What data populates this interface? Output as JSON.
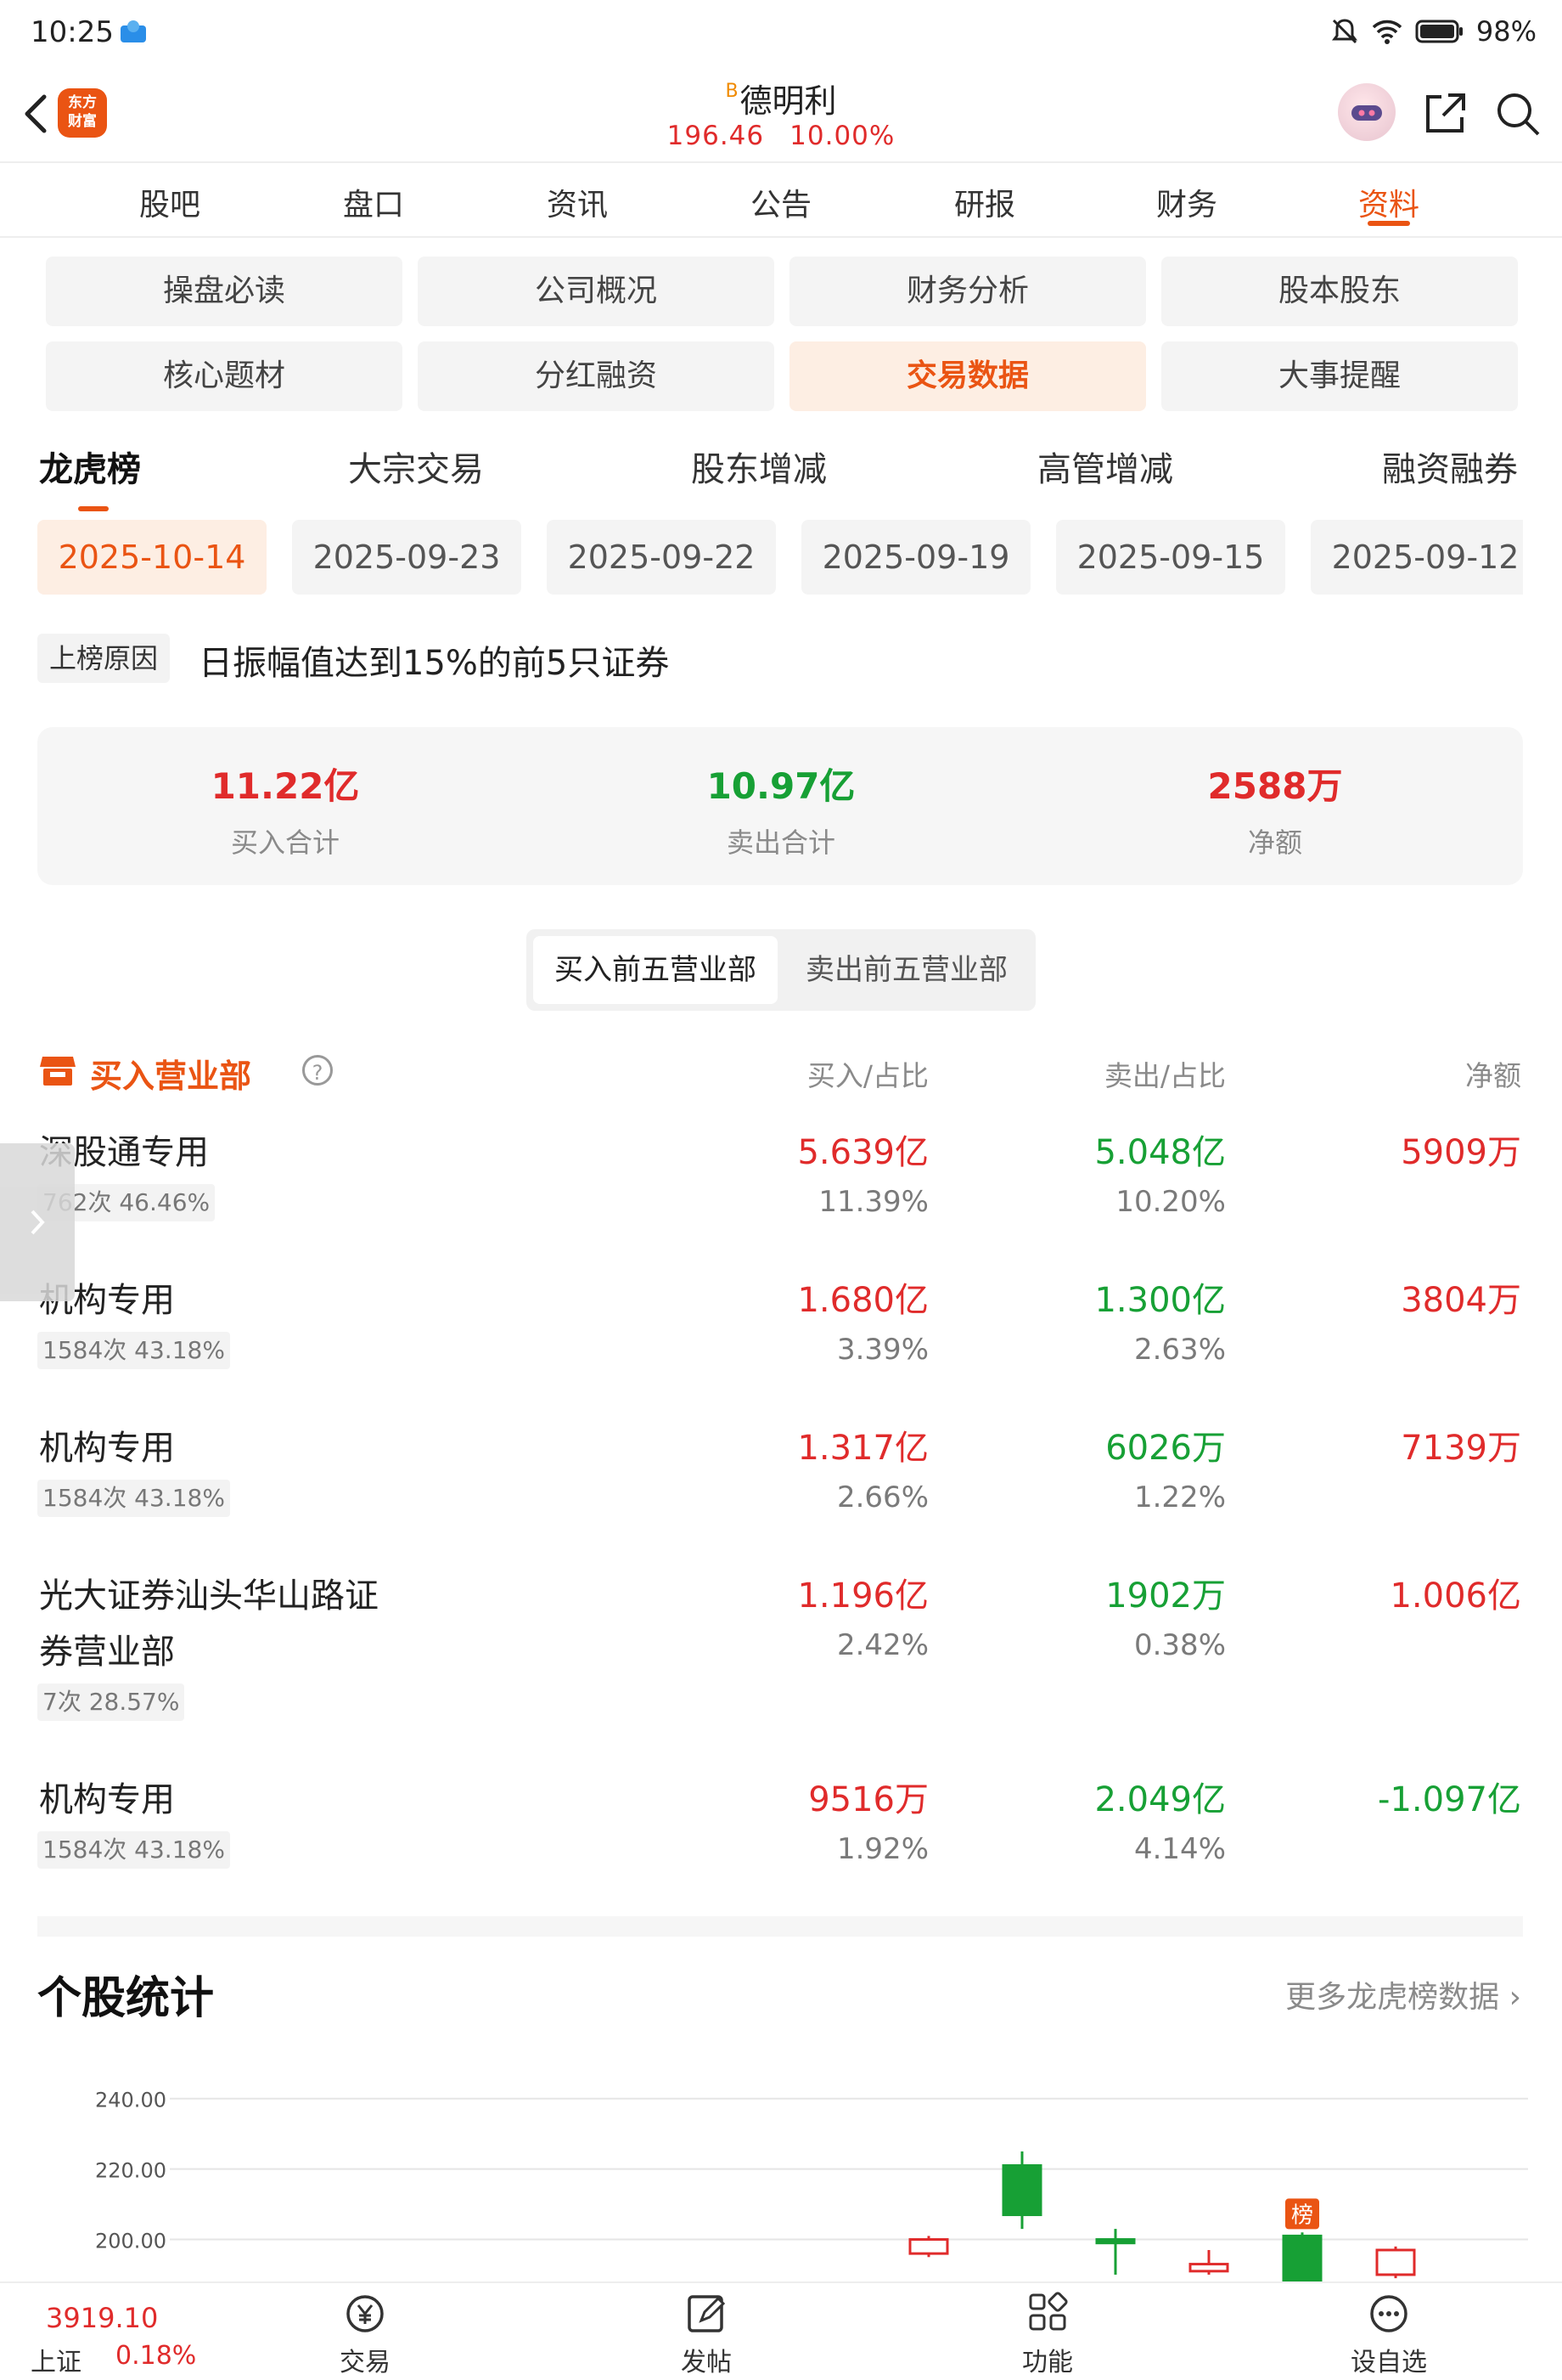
{
  "status_bar": {
    "time": "10:25",
    "battery": "98%"
  },
  "header": {
    "logo_text_1": "东方",
    "logo_text_2": "财富",
    "stock_badge": "B",
    "stock_name": "德明利",
    "price": "196.46",
    "change_pct": "10.00%"
  },
  "main_tabs": [
    "股吧",
    "盘口",
    "资讯",
    "公告",
    "研报",
    "财务",
    "资料"
  ],
  "main_tab_active": "资料",
  "grid_buttons": [
    "操盘必读",
    "公司概况",
    "财务分析",
    "股本股东",
    "核心题材",
    "分红融资",
    "交易数据",
    "大事提醒"
  ],
  "grid_active": "交易数据",
  "secondary_tabs": [
    "龙虎榜",
    "大宗交易",
    "股东增减",
    "高管增减",
    "融资融券"
  ],
  "dates": [
    "2025-10-14",
    "2025-09-23",
    "2025-09-22",
    "2025-09-19",
    "2025-09-15",
    "2025-09-12"
  ],
  "reason": {
    "tag": "上榜原因",
    "text": "日振幅值达到15%的前5只证券"
  },
  "summary": {
    "buy_total": "11.22亿",
    "buy_label": "买入合计",
    "sell_total": "10.97亿",
    "sell_label": "卖出合计",
    "net": "2588万",
    "net_label": "净额"
  },
  "segment": {
    "buy_top5": "买入前五营业部",
    "sell_top5": "卖出前五营业部"
  },
  "table": {
    "title": "买入营业部",
    "help": "?",
    "col_buy": "买入/占比",
    "col_sell": "卖出/占比",
    "col_net": "净额",
    "rows": [
      {
        "name": "深股通专用",
        "badge": "762次 46.46%",
        "buy": "5.639亿",
        "buy_pct": "11.39%",
        "sell": "5.048亿",
        "sell_pct": "10.20%",
        "net": "5909万"
      },
      {
        "name": "机构专用",
        "badge": "1584次 43.18%",
        "buy": "1.680亿",
        "buy_pct": "3.39%",
        "sell": "1.300亿",
        "sell_pct": "2.63%",
        "net": "3804万"
      },
      {
        "name": "机构专用",
        "badge": "1584次 43.18%",
        "buy": "1.317亿",
        "buy_pct": "2.66%",
        "sell": "6026万",
        "sell_pct": "1.22%",
        "net": "7139万"
      },
      {
        "name": "光大证券汕头华山路证券营业部",
        "badge": "7次 28.57%",
        "buy": "1.196亿",
        "buy_pct": "2.42%",
        "sell": "1902万",
        "sell_pct": "0.38%",
        "net": "1.006亿"
      },
      {
        "name": "机构专用",
        "badge": "1584次 43.18%",
        "buy": "9516万",
        "buy_pct": "1.92%",
        "sell": "2.049亿",
        "sell_pct": "4.14%",
        "net": "-1.097亿"
      }
    ]
  },
  "stats": {
    "title": "个股统计",
    "more": "更多龙虎榜数据"
  },
  "chart_data": {
    "type": "candlestick",
    "y_ticks": [
      "240.00",
      "220.00",
      "200.00"
    ],
    "ylim": [
      190,
      245
    ],
    "marker_label": "榜",
    "candles": [
      {
        "open": 196,
        "close": 200,
        "high": 201,
        "low": 195,
        "dir": "up"
      },
      {
        "open": 221,
        "close": 207,
        "high": 225,
        "low": 203,
        "dir": "down"
      },
      {
        "open": 200,
        "close": 199,
        "high": 203,
        "low": 190,
        "dir": "down"
      },
      {
        "open": 193,
        "close": 191,
        "high": 197,
        "low": 190,
        "dir": "up"
      },
      {
        "open": 201,
        "close": 188,
        "high": 202,
        "low": 186,
        "dir": "down",
        "marked": true
      },
      {
        "open": 190,
        "close": 197,
        "high": 198,
        "low": 189,
        "dir": "up"
      }
    ]
  },
  "bottom_bar": {
    "index_value": "3919.10",
    "index_name": "上证",
    "index_change": "0.18%",
    "nav": [
      "交易",
      "发帖",
      "功能",
      "设自选"
    ]
  }
}
